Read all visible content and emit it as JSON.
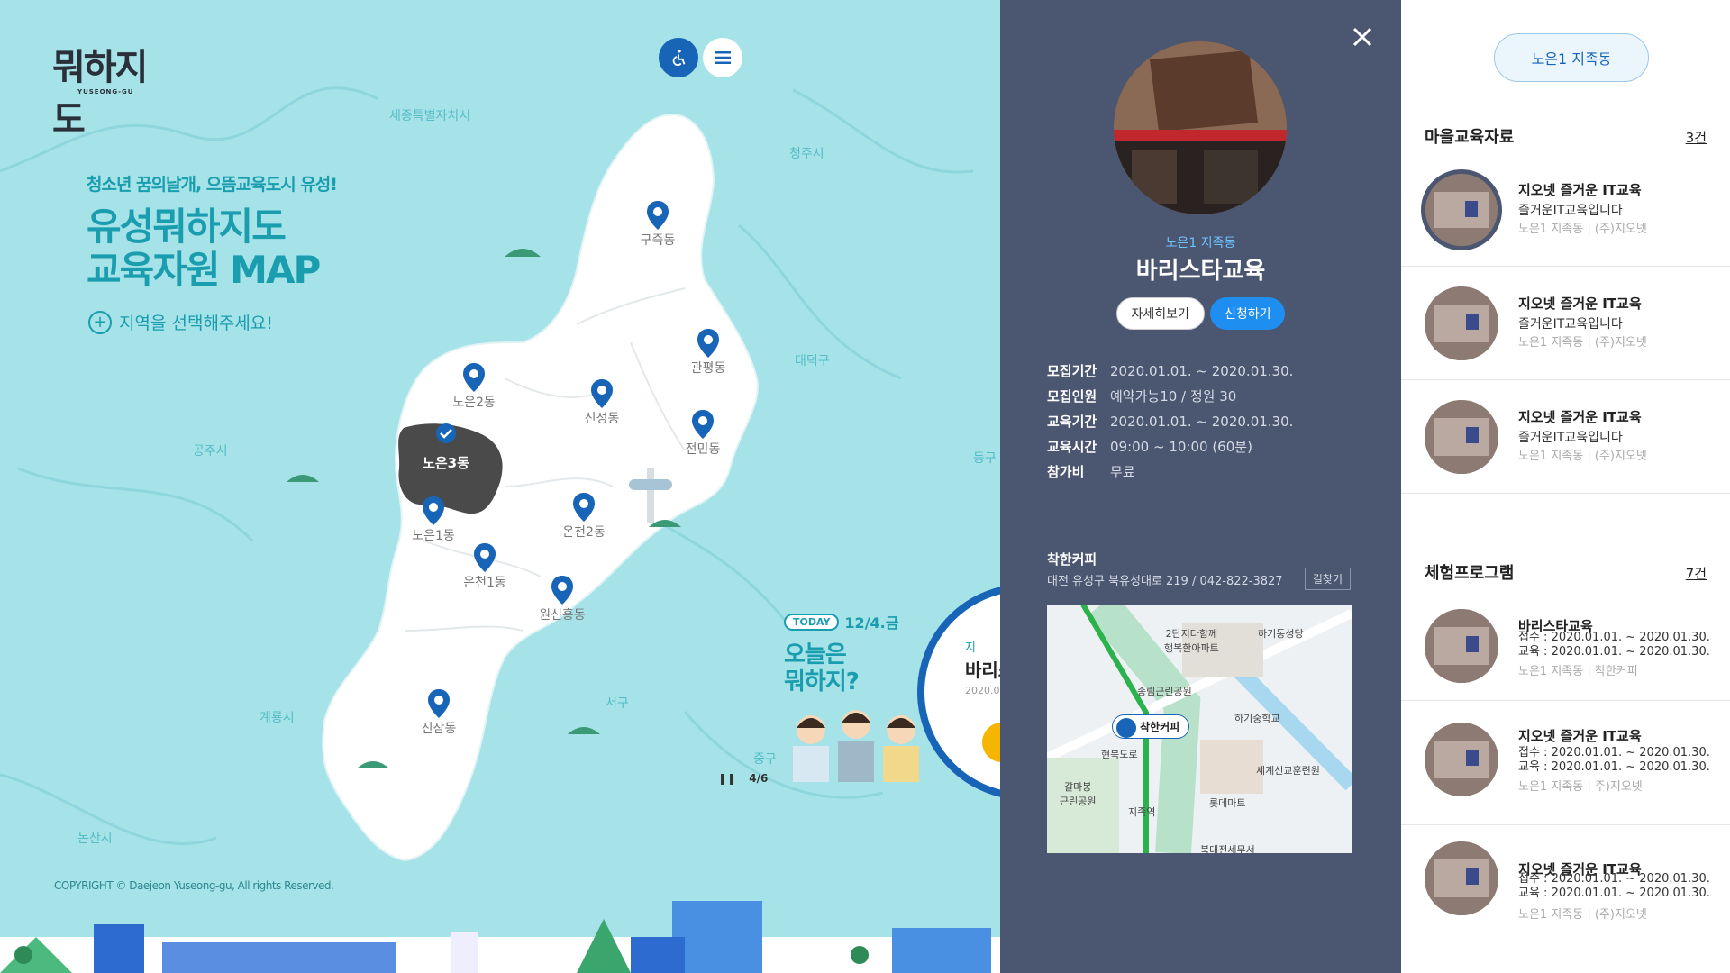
{
  "logo": {
    "text": "뭐하지도",
    "sub": "YUSEONG-GU"
  },
  "hero": {
    "slogan": "청소년 꿈의날개, 으뜸교육도시 유성!",
    "title_line1": "유성뭐하지도",
    "title_line2": "교육자원 MAP",
    "select_hint": "지역을 선택해주세요!"
  },
  "cities": {
    "sejong": "세종특별자치시",
    "cheongju": "청주시",
    "daedeok": "대덕구",
    "gongju": "공주시",
    "donggu": "동구",
    "seogu": "서구",
    "gyeryong": "계룡시",
    "junggu": "중구",
    "nonsan": "논산시"
  },
  "dongs": {
    "gujeuk": "구즉동",
    "gwanpyeong": "관평동",
    "noeun2": "노은2동",
    "sinseong": "신성동",
    "jeonmin": "전민동",
    "noeun3": "노은3동",
    "noeun1": "노은1동",
    "oncheon2": "온천2동",
    "oncheon1": "온천1동",
    "wonsinheung": "원신흥동",
    "jinjam": "진잠동"
  },
  "today": {
    "badge": "TODAY",
    "date": "12/4.금",
    "title_line1": "오늘은",
    "title_line2": "뭐하지?",
    "pager": "4/6",
    "card_sub": "지",
    "card_name": "바리스",
    "card_date": "2020.01"
  },
  "copyright": "COPYRIGHT © Daejeon Yuseong-gu, All rights Reserved.",
  "detail": {
    "area": "노은1 지족동",
    "title": "바리스타교육",
    "btn_detail": "자세히보기",
    "btn_apply": "신청하기",
    "info": [
      {
        "key": "모집기간",
        "val": "2020.01.01. ~ 2020.01.30."
      },
      {
        "key": "모집인원",
        "val": "예약가능10 / 정원 30"
      },
      {
        "key": "교육기간",
        "val": "2020.01.01. ~ 2020.01.30."
      },
      {
        "key": "교육시간",
        "val": "09:00 ~ 10:00 (60분)"
      },
      {
        "key": "참가비",
        "val": "무료"
      }
    ],
    "place_name": "착한커피",
    "place_addr": "대전 유성구 북유성대로 219 / 042-822-3827",
    "directions": "길찾기",
    "map_labels": {
      "apt": "2단지다함께\n행복한아파트",
      "hagi_seodang": "하기동성당",
      "park1": "송림근린공원",
      "school": "하기중학교",
      "bubble": "착한커피",
      "park2": "갈마봉\n근린공원",
      "station": "지족역",
      "training": "세계선교훈련원",
      "mart": "롯데마트",
      "tax": "북대전세무서",
      "hyeonbuk": "현북도로"
    }
  },
  "list": {
    "area_pill": "노은1 지족동",
    "section1_title": "마을교육자료",
    "section1_count": "3건",
    "section1_items": [
      {
        "title": "지오넷 즐거운 IT교육",
        "desc": "즐거운IT교육입니다",
        "meta": "노은1 지족동 | (주)지오넷"
      },
      {
        "title": "지오넷 즐거운 IT교육",
        "desc": "즐거운IT교육입니다",
        "meta": "노은1 지족동 | (주)지오넷"
      },
      {
        "title": "지오넷 즐거운 IT교육",
        "desc": "즐거운IT교육입니다",
        "meta": "노은1 지족동 | (주)지오넷"
      }
    ],
    "section2_title": "체험프로그램",
    "section2_count": "7건",
    "section2_items": [
      {
        "title": "바리스타교육",
        "l1": "접수 : 2020.01.01. ~ 2020.01.30.",
        "l2": "교육 : 2020.01.01. ~ 2020.01.30.",
        "meta": "노은1 지족동 | 착한커피"
      },
      {
        "title": "지오넷 즐거운 IT교육",
        "l1": "접수 : 2020.01.01. ~ 2020.01.30.",
        "l2": "교육 : 2020.01.01. ~ 2020.01.30.",
        "meta": "노은1 지족동 | 주)지오넷"
      },
      {
        "title": "지오넷 즐거운 IT교육",
        "l1": "접수 : 2020.01.01. ~ 2020.01.30.",
        "l2": "교육 : 2020.01.01. ~ 2020.01.30.",
        "meta": "노은1 지족동 | (주)지오넷"
      }
    ]
  },
  "colors": {
    "map_bg": "#a5e3e8",
    "accent_teal": "#1a9dae",
    "pin_blue": "#1865b8",
    "panel_dark": "#4b5670",
    "apply_blue": "#1e8ef0",
    "selected_region": "#4a4a4a"
  },
  "icons": {
    "accessibility": "accessibility-icon",
    "menu": "hamburger-menu-icon",
    "close": "close-icon",
    "pin": "map-pin-icon",
    "check": "check-icon",
    "plus": "plus-circle-icon",
    "pause": "pause-icon",
    "cup": "coffee-cup-icon"
  }
}
